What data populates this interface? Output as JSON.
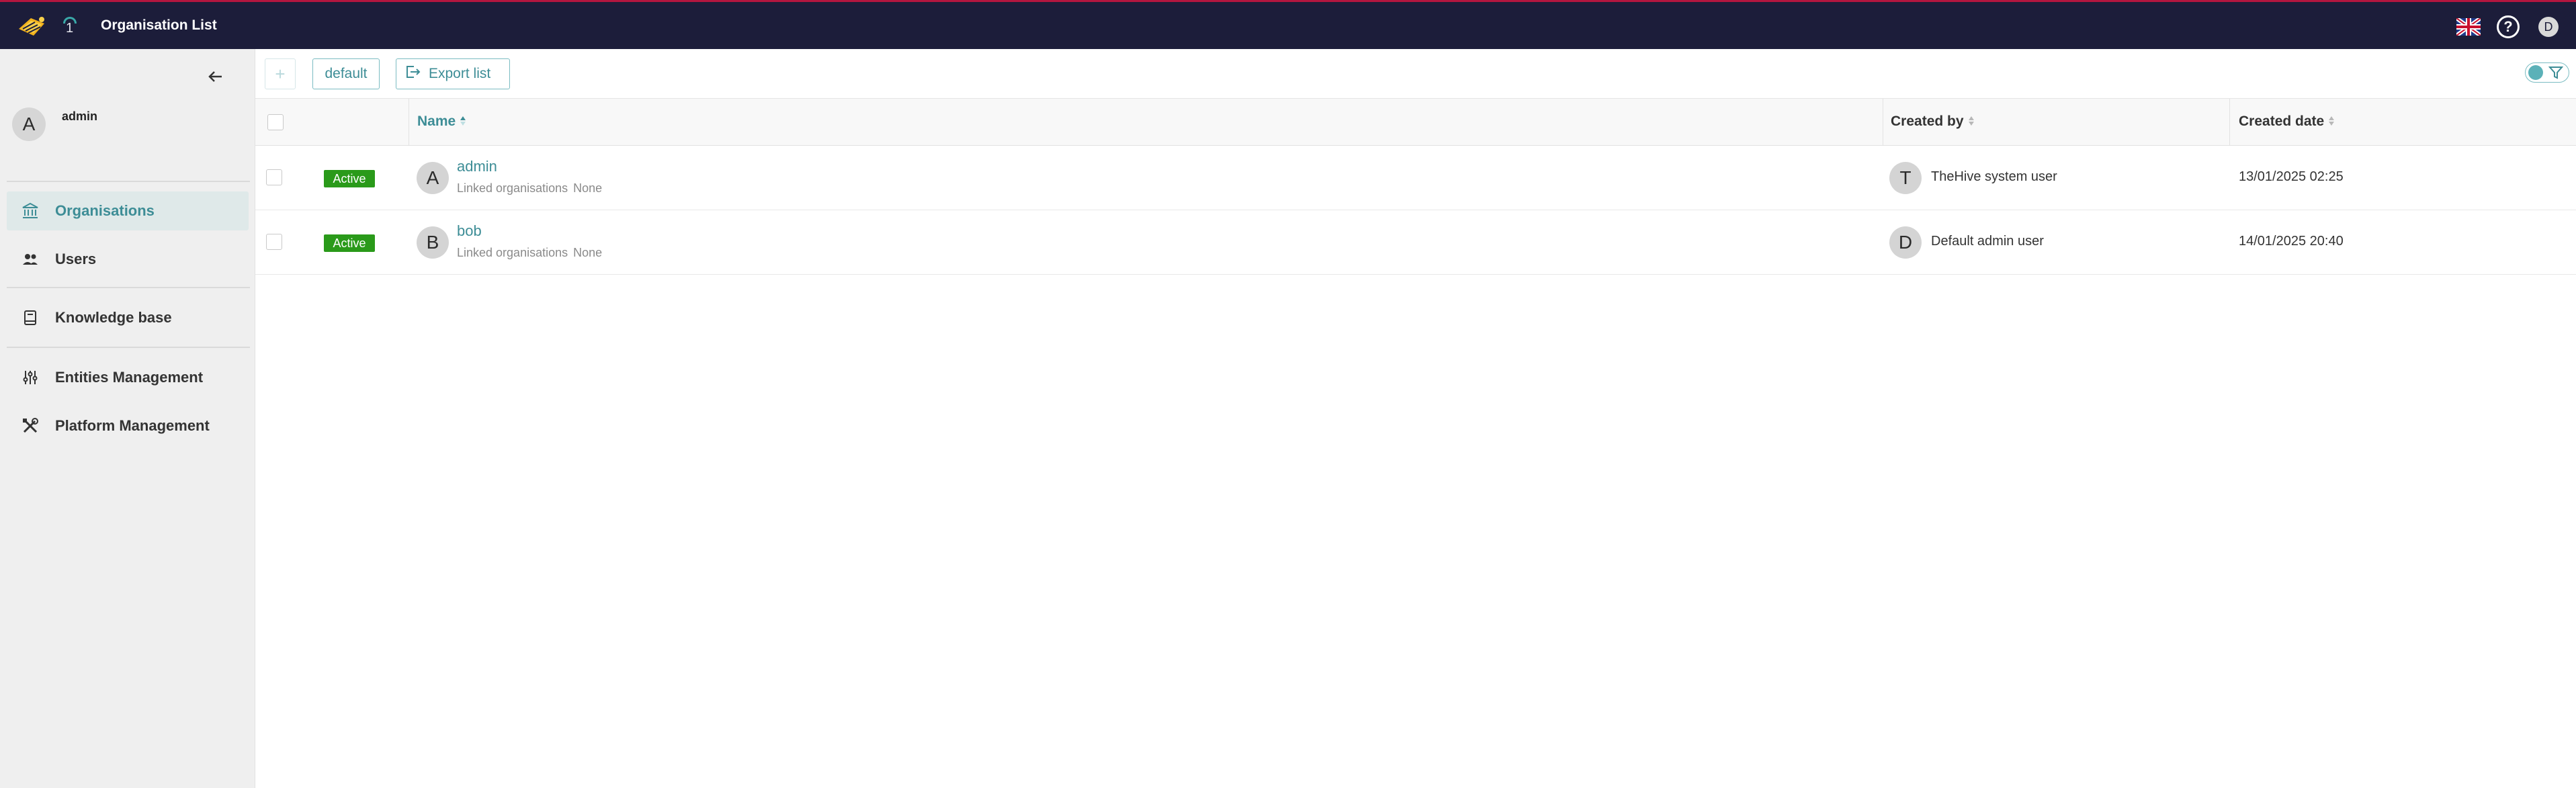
{
  "topbar": {
    "title": "Organisation List",
    "notification_count": "1",
    "user_initial": "D",
    "help_symbol": "?",
    "flag": "uk-flag",
    "accent_color": "#b3163f",
    "bg_color": "#1c1d3a"
  },
  "sidebar": {
    "user": {
      "initial": "A",
      "name": "admin"
    },
    "items": [
      {
        "label": "Organisations",
        "icon": "bank-icon",
        "active": true
      },
      {
        "label": "Users",
        "icon": "users-icon",
        "active": false
      },
      {
        "label": "Knowledge base",
        "icon": "book-icon",
        "active": false
      },
      {
        "label": "Entities Management",
        "icon": "sliders-icon",
        "active": false
      },
      {
        "label": "Platform Management",
        "icon": "tools-icon",
        "active": false
      }
    ]
  },
  "toolbar": {
    "add_label": "+",
    "default_label": "default",
    "export_label": "Export list"
  },
  "table": {
    "columns": [
      "Name",
      "Created by",
      "Created date"
    ],
    "rows": [
      {
        "status": "Active",
        "initial": "A",
        "name": "admin",
        "linked_label": "Linked organisations",
        "linked_value": "None",
        "creator_initial": "T",
        "created_by": "TheHive system user",
        "created_date": "13/01/2025 02:25"
      },
      {
        "status": "Active",
        "initial": "B",
        "name": "bob",
        "linked_label": "Linked organisations",
        "linked_value": "None",
        "creator_initial": "D",
        "created_by": "Default admin user",
        "created_date": "14/01/2025 20:40"
      }
    ]
  },
  "colors": {
    "accent": "#3d8d96",
    "status_active": "#2a9a1a"
  }
}
